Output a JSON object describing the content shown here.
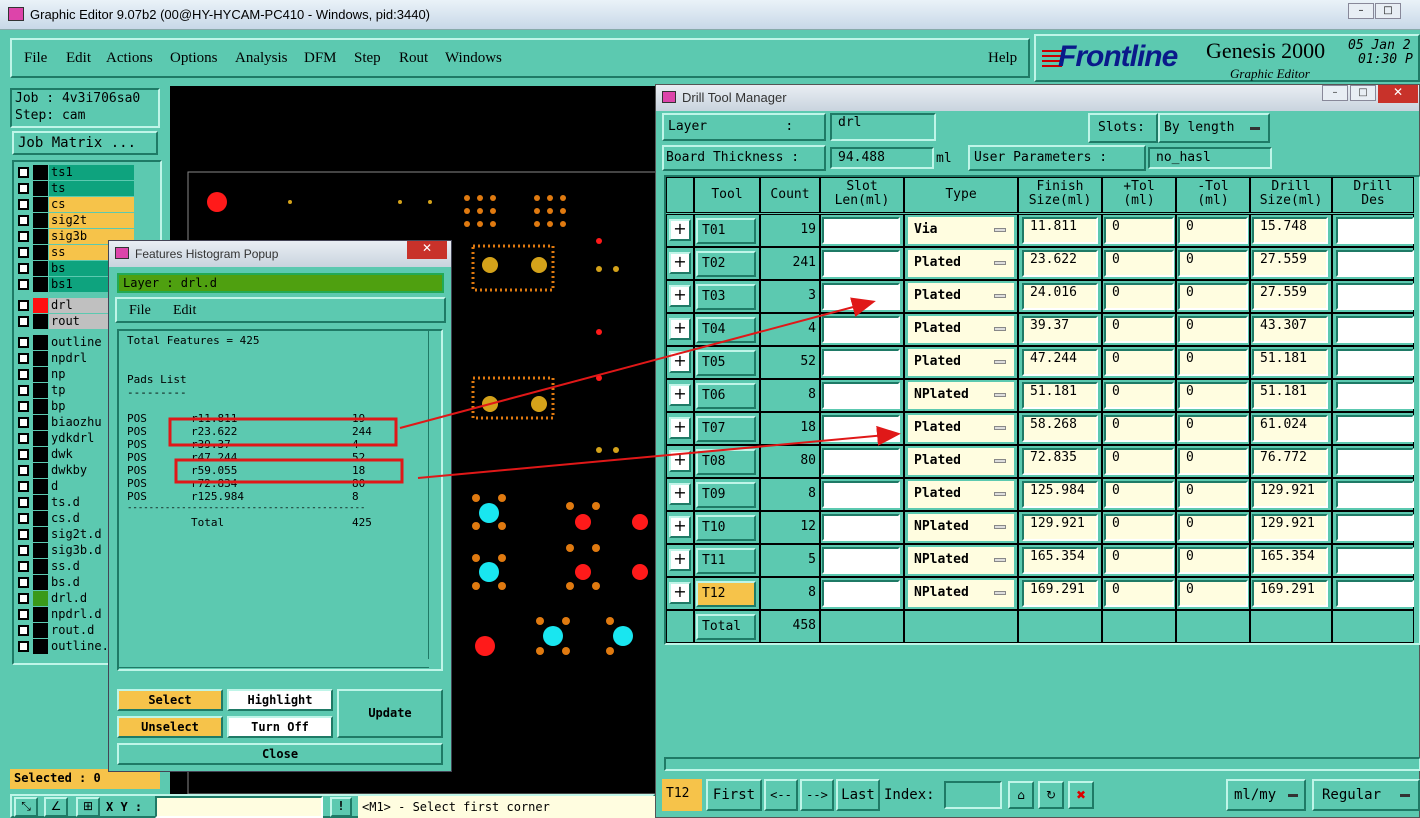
{
  "window": {
    "title": "Graphic Editor 9.07b2 (00@HY-HYCAM-PC410 - Windows, pid:3440)"
  },
  "menu": [
    "File",
    "Edit",
    "Actions",
    "Options",
    "Analysis",
    "DFM",
    "Step",
    "Rout",
    "Windows"
  ],
  "help": "Help",
  "logo": {
    "brand": "Frontline",
    "product": "Genesis 2000",
    "sub": "Graphic Editor",
    "date": "05 Jan 2",
    "time": "01:30 P"
  },
  "job": {
    "job": "Job : 4v3i706sa0",
    "step": "Step: cam",
    "matrix": "Job Matrix ..."
  },
  "layers_a": [
    {
      "n": "ts1",
      "c": "#0ea37e"
    },
    {
      "n": "ts",
      "c": "#0ea37e"
    },
    {
      "n": "cs",
      "c": "#f6c34a"
    },
    {
      "n": "sig2t",
      "c": "#f6c34a"
    },
    {
      "n": "sig3b",
      "c": "#f6c34a"
    },
    {
      "n": "ss",
      "c": "#f6c34a"
    },
    {
      "n": "bs",
      "c": "#0ea37e"
    },
    {
      "n": "bs1",
      "c": "#0ea37e"
    }
  ],
  "layers_b": [
    {
      "n": "drl",
      "c": "#c0c0c0",
      "sw": "#ff1010"
    },
    {
      "n": "rout",
      "c": "#c0c0c0",
      "sw": "#000"
    }
  ],
  "layers_c": [
    "outline",
    "npdrl",
    "np",
    "tp",
    "bp",
    "biaozhu",
    "ydkdrl",
    "dwk",
    "dwkby",
    "d",
    "ts.d",
    "cs.d",
    "sig2t.d",
    "sig3b.d",
    "ss.d",
    "bs.d",
    "drl.d",
    "npdrl.d",
    "rout.d",
    "outline."
  ],
  "selected": "Selected : 0",
  "xy_label": "X Y :",
  "status_msg": "<M1> - Select first corner",
  "hist": {
    "title": "Features Histogram Popup",
    "layer": "Layer : drl.d",
    "menu": [
      "File",
      "Edit"
    ],
    "total_line": "Total Features = 425",
    "pads_title": "Pads List",
    "pads_ul": "---------",
    "rows": [
      {
        "k": "POS",
        "s": "r11.811",
        "n": "19"
      },
      {
        "k": "POS",
        "s": "r23.622",
        "n": "244"
      },
      {
        "k": "POS",
        "s": "r39.37",
        "n": "4"
      },
      {
        "k": "POS",
        "s": "r47.244",
        "n": "52"
      },
      {
        "k": "POS",
        "s": "r59.055",
        "n": "18"
      },
      {
        "k": "POS",
        "s": "r72.834",
        "n": "80"
      },
      {
        "k": "POS",
        "s": "r125.984",
        "n": "8"
      }
    ],
    "rule": "--------------------------------------------",
    "total_label": "Total",
    "total_value": "425",
    "buttons": {
      "select": "Select",
      "highlight": "Highlight",
      "unselect": "Unselect",
      "turnoff": "Turn Off",
      "update": "Update",
      "close": "Close"
    }
  },
  "dtm": {
    "title": "Drill Tool Manager",
    "layer_label": "Layer          :",
    "layer_value": "drl",
    "slots_label": "Slots:",
    "slots_value": "By length",
    "thick_label": "Board Thickness :",
    "thick_value": "94.488",
    "thick_unit": "ml",
    "user_params": "User Parameters :",
    "user_value": "no_hasl",
    "headers": [
      "Tool",
      "Count",
      "Slot\nLen(ml)",
      "Type",
      "Finish\nSize(ml)",
      "+Tol\n(ml)",
      "-Tol\n(ml)",
      "Drill\nSize(ml)",
      "Drill\nDes"
    ],
    "rows": [
      {
        "tool": "T01",
        "count": "19",
        "type": "Via",
        "finish": "11.811",
        "ptol": "0",
        "mtol": "0",
        "drill": "15.748"
      },
      {
        "tool": "T02",
        "count": "241",
        "type": "Plated",
        "finish": "23.622",
        "ptol": "0",
        "mtol": "0",
        "drill": "27.559"
      },
      {
        "tool": "T03",
        "count": "3",
        "type": "Plated",
        "finish": "24.016",
        "ptol": "0",
        "mtol": "0",
        "drill": "27.559"
      },
      {
        "tool": "T04",
        "count": "4",
        "type": "Plated",
        "finish": "39.37",
        "ptol": "0",
        "mtol": "0",
        "drill": "43.307"
      },
      {
        "tool": "T05",
        "count": "52",
        "type": "Plated",
        "finish": "47.244",
        "ptol": "0",
        "mtol": "0",
        "drill": "51.181"
      },
      {
        "tool": "T06",
        "count": "8",
        "type": "NPlated",
        "finish": "51.181",
        "ptol": "0",
        "mtol": "0",
        "drill": "51.181"
      },
      {
        "tool": "T07",
        "count": "18",
        "type": "Plated",
        "finish": "58.268",
        "ptol": "0",
        "mtol": "0",
        "drill": "61.024"
      },
      {
        "tool": "T08",
        "count": "80",
        "type": "Plated",
        "finish": "72.835",
        "ptol": "0",
        "mtol": "0",
        "drill": "76.772"
      },
      {
        "tool": "T09",
        "count": "8",
        "type": "Plated",
        "finish": "125.984",
        "ptol": "0",
        "mtol": "0",
        "drill": "129.921"
      },
      {
        "tool": "T10",
        "count": "12",
        "type": "NPlated",
        "finish": "129.921",
        "ptol": "0",
        "mtol": "0",
        "drill": "129.921"
      },
      {
        "tool": "T11",
        "count": "5",
        "type": "NPlated",
        "finish": "165.354",
        "ptol": "0",
        "mtol": "0",
        "drill": "165.354"
      },
      {
        "tool": "T12",
        "count": "8",
        "type": "NPlated",
        "finish": "169.291",
        "ptol": "0",
        "mtol": "0",
        "drill": "169.291"
      }
    ],
    "total_label": "Total",
    "total_value": "458",
    "footer": {
      "current": "T12",
      "first": "First",
      "prev": "<--",
      "next": "-->",
      "last": "Last",
      "index": "Index:",
      "units": "ml/my",
      "mode": "Regular"
    }
  },
  "colors": {
    "panel": "#5cc9b0",
    "highlight": "#f6c34a",
    "annotation_red": "#e01818"
  }
}
